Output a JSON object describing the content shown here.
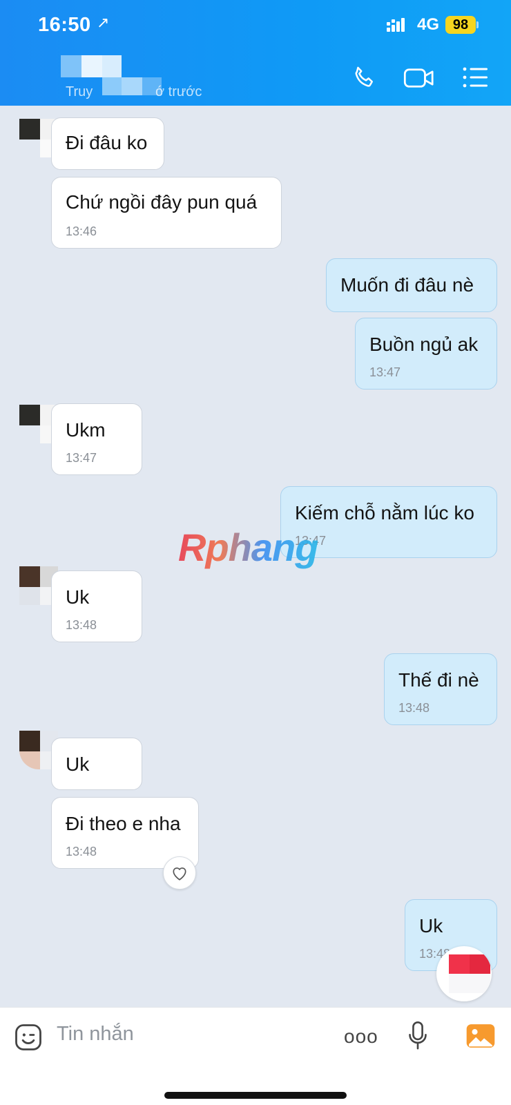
{
  "status_bar": {
    "time": "16:50",
    "arrow": "↗",
    "network": "4G",
    "battery": "98"
  },
  "header": {
    "subtitle_start": "Truy",
    "subtitle_end": "ớ trước",
    "icons": [
      "phone-icon",
      "video-call-icon",
      "menu-list-icon"
    ]
  },
  "messages": [
    {
      "id": "m1",
      "side": "in",
      "text": "Đi đâu ko",
      "time": ""
    },
    {
      "id": "m2",
      "side": "in",
      "text": "Chứ ngồi đây pun quá",
      "time": "13:46"
    },
    {
      "id": "m3",
      "side": "out",
      "text": "Muốn đi đâu nè",
      "time": ""
    },
    {
      "id": "m4",
      "side": "out",
      "text": "Buồn ngủ ak",
      "time": "13:47"
    },
    {
      "id": "m5",
      "side": "in",
      "text": "Ukm",
      "time": "13:47"
    },
    {
      "id": "m6",
      "side": "out",
      "text": "Kiếm chỗ nằm lúc ko",
      "time": "13:47"
    },
    {
      "id": "m7",
      "side": "in",
      "text": "Uk",
      "time": "13:48"
    },
    {
      "id": "m8",
      "side": "out",
      "text": "Thế đi nè",
      "time": "13:48"
    },
    {
      "id": "m9",
      "side": "in",
      "text": "Uk",
      "time": ""
    },
    {
      "id": "m10",
      "side": "in",
      "text": "Đi theo e nha",
      "time": "13:48"
    },
    {
      "id": "m11",
      "side": "out",
      "text": "Uk",
      "time": "13:48"
    }
  ],
  "watermark": "Rphang",
  "input_bar": {
    "placeholder": "Tin nhắn",
    "more_label": "ooo"
  },
  "colors": {
    "header_blue": "#1b8cf3",
    "outgoing_bubble": "#d2ecfb",
    "incoming_bubble": "#ffffff",
    "chat_background": "#e2e8f1",
    "battery_yellow": "#f6d51f",
    "image_icon_orange": "#f79a2e"
  }
}
